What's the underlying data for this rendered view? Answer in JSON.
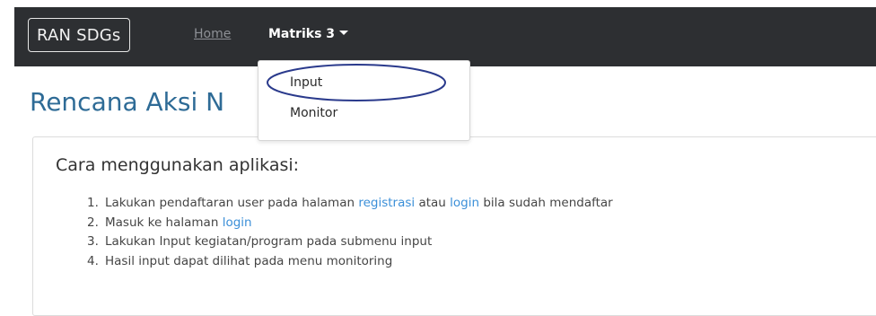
{
  "navbar": {
    "brand": "RAN SDGs",
    "home_label": "Home",
    "matriks_label": "Matriks 3"
  },
  "dropdown": {
    "items": [
      {
        "label": "Input"
      },
      {
        "label": "Monitor"
      }
    ]
  },
  "page": {
    "title": "Rencana Aksi N"
  },
  "instructions": {
    "heading": "Cara menggunakan aplikasi:",
    "steps": [
      {
        "num": "1.",
        "pre": "Lakukan pendaftaran user pada halaman ",
        "link1": "registrasi",
        "mid": " atau ",
        "link2": "login",
        "post": " bila sudah mendaftar"
      },
      {
        "num": "2.",
        "pre": "Masuk ke halaman ",
        "link": "login"
      },
      {
        "num": "3.",
        "text": "Lakukan Input kegiatan/program pada submenu input"
      },
      {
        "num": "4.",
        "text": "Hasil input dapat dilihat pada menu monitoring"
      }
    ]
  },
  "colors": {
    "navbar_bg": "#2d2f32",
    "title": "#2e6b96",
    "link": "#3b8fd8",
    "annotation": "#2a3a8c"
  }
}
